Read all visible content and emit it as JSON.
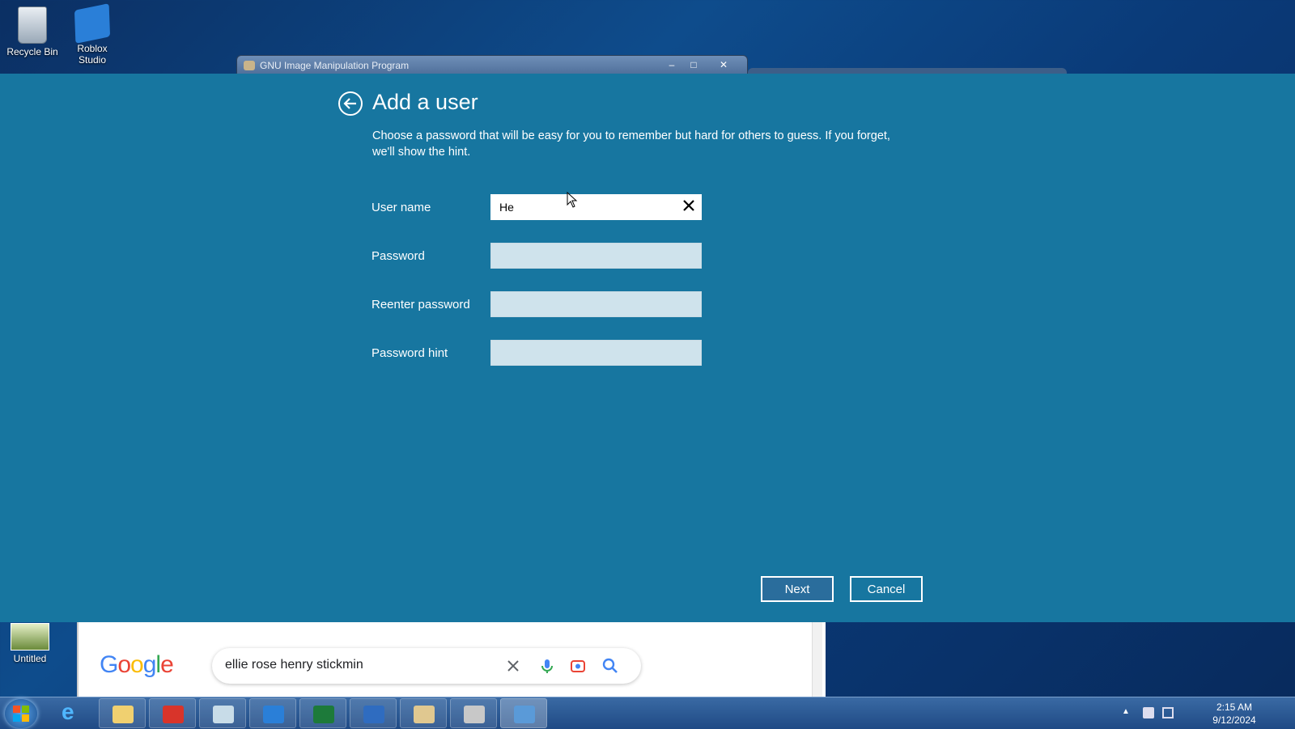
{
  "desktop": {
    "icons": [
      {
        "label": "Recycle Bin"
      },
      {
        "label": "Roblox Studio"
      },
      {
        "label": "Untitled"
      }
    ]
  },
  "gimp_window": {
    "title": "GNU Image Manipulation Program"
  },
  "dialog": {
    "title": "Add a user",
    "description": "Choose a password that will be easy for you to remember but hard for others to guess. If you forget, we'll show the hint.",
    "fields": [
      {
        "label": "User name",
        "value": "He"
      },
      {
        "label": "Password",
        "value": ""
      },
      {
        "label": "Reenter password",
        "value": ""
      },
      {
        "label": "Password hint",
        "value": ""
      }
    ],
    "next_label": "Next",
    "cancel_label": "Cancel"
  },
  "browser": {
    "logo": "Google",
    "search_query": "ellie rose henry stickmin"
  },
  "taskbar": {
    "pinned": [
      "internet-explorer",
      "file-explorer",
      "app-red",
      "app-notepad",
      "roblox-studio",
      "project",
      "app-sun",
      "paint",
      "app-gray",
      "control-panel"
    ]
  },
  "clock": {
    "time": "2:15 AM",
    "date": "9/12/2024"
  },
  "colors": {
    "panel_bg": "#1776a0",
    "accent": "#ffffff"
  }
}
